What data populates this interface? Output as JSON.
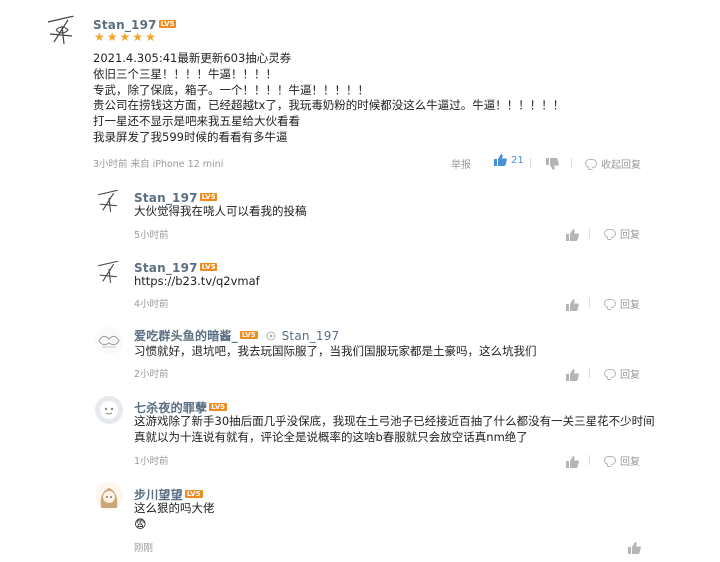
{
  "colors": {
    "username": "#5b6f82",
    "badge": "#f08b20",
    "star": "#f4a425",
    "like_active": "#4a90d9",
    "meta": "#9a9a9a"
  },
  "main_comment": {
    "username": "Stan_197",
    "level": "LV5",
    "rating": 5,
    "lines": [
      "2021.4.305:41最新更新603抽心灵券",
      "依旧三个三星！！！！牛逼！！！！",
      "专武，除了保底，箱子。一个！！！！牛逼！！！！！",
      "贵公司在捞钱这方面，已经超越tx了，我玩毒奶粉的时候都没这么牛逼过。牛逼！！！！！！",
      "打一星还不显示是吧来我五星给大伙看看",
      "我录屏发了我599时候的看看有多牛逼"
    ],
    "meta": "3小时前 来自 iPhone 12 mini",
    "report_label": "举报",
    "like_count": "21",
    "collapse_label": "收起回复"
  },
  "replies": [
    {
      "username": "Stan_197",
      "level": "LV5",
      "lines": [
        "大伙觉得我在哓人可以看我的投稿"
      ],
      "meta": "5小时前",
      "reply_label": "回复"
    },
    {
      "username": "Stan_197",
      "level": "LV5",
      "lines": [
        "https://b23.tv/q2vmaf"
      ],
      "meta": "4小时前",
      "reply_label": "回复"
    },
    {
      "username": "爱吃群头鱼的暗酱_",
      "level": "LV5",
      "reply_to": "Stan_197",
      "lines": [
        "习惯就好，退坑吧，我去玩国际服了，当我们国服玩家都是土豪吗，这么坑我们"
      ],
      "meta": "2小时前",
      "reply_label": "回复"
    },
    {
      "username": "七杀夜的罪孽",
      "level": "LV5",
      "lines": [
        "这游戏除了新手30抽后面几乎没保底，我现在土弓池子已经接近百抽了什么都没有一关三星花不少时间",
        "真就以为十连说有就有，评论全是说概率的这啥b春服就只会放空话真nm绝了"
      ],
      "meta": "1小时前",
      "reply_label": "回复"
    },
    {
      "username": "步川望望",
      "level": "LV5",
      "lines": [
        "这么狠的吗大佬"
      ],
      "emoji": "😨",
      "meta": "刚刚"
    }
  ]
}
